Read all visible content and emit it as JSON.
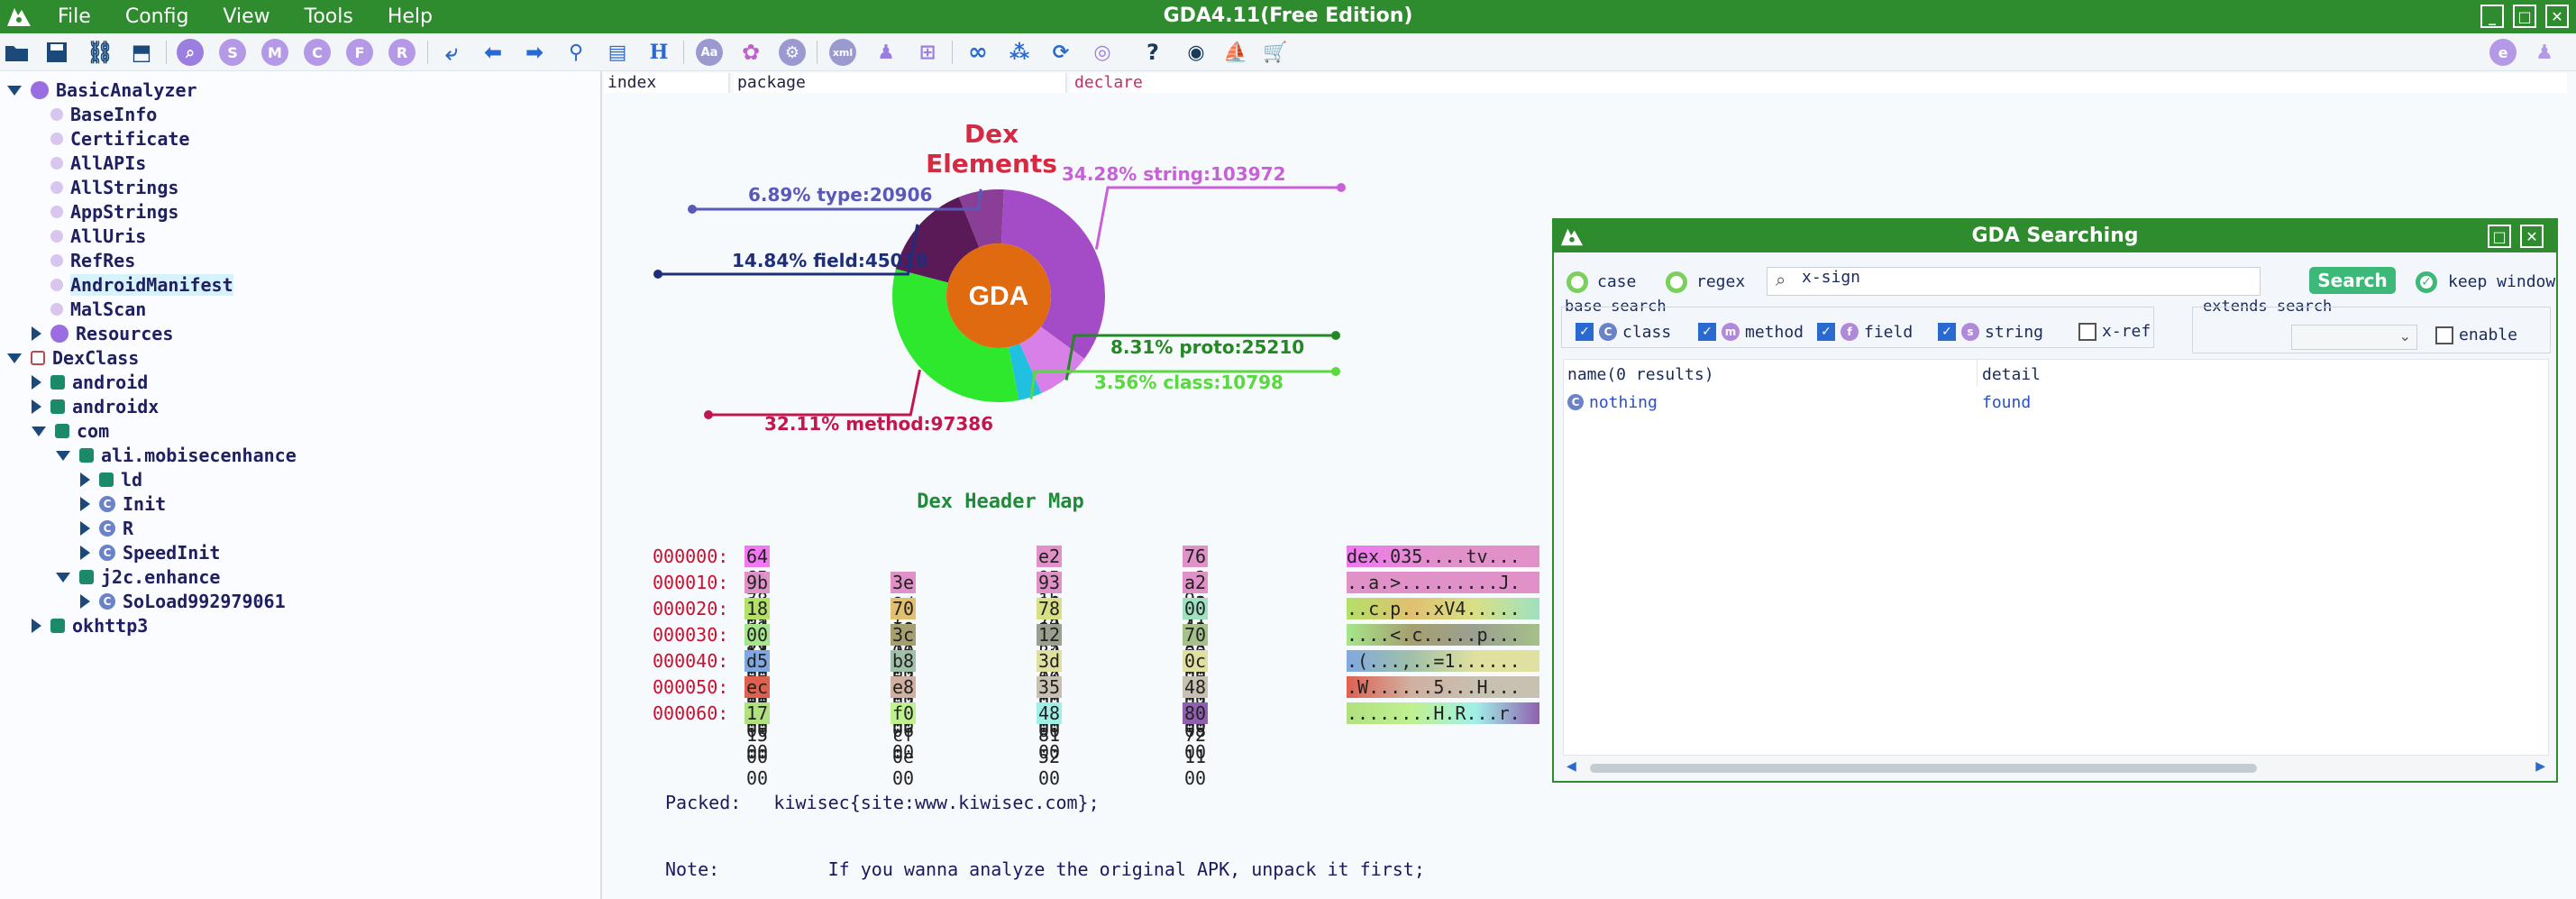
{
  "window": {
    "title": "GDA4.11(Free Edition)"
  },
  "menu": [
    "File",
    "Config",
    "View",
    "Tools",
    "Help"
  ],
  "toolbar": {
    "letter_buttons": [
      "S",
      "M",
      "C",
      "F",
      "R"
    ],
    "h_label": "H",
    "aa_label": "Aa",
    "xml_label": "xml",
    "help_label": "?"
  },
  "tree": [
    {
      "label": "BasicAnalyzer",
      "level": 0,
      "toggle": "expanded",
      "icon": "basic-analyzer-icon"
    },
    {
      "label": "BaseInfo",
      "level": 1,
      "toggle": "none",
      "icon": "dot-icon"
    },
    {
      "label": "Certificate",
      "level": 1,
      "toggle": "none",
      "icon": "dot-icon"
    },
    {
      "label": "AllAPIs",
      "level": 1,
      "toggle": "none",
      "icon": "dot-icon"
    },
    {
      "label": "AllStrings",
      "level": 1,
      "toggle": "none",
      "icon": "dot-icon"
    },
    {
      "label": "AppStrings",
      "level": 1,
      "toggle": "none",
      "icon": "dot-icon"
    },
    {
      "label": "AllUris",
      "level": 1,
      "toggle": "none",
      "icon": "dot-icon"
    },
    {
      "label": "RefRes",
      "level": 1,
      "toggle": "none",
      "icon": "dot-icon"
    },
    {
      "label": "AndroidManifest",
      "level": 1,
      "toggle": "none",
      "icon": "dot-icon",
      "selected": true
    },
    {
      "label": "MalScan",
      "level": 1,
      "toggle": "none",
      "icon": "dot-icon"
    },
    {
      "label": "Resources",
      "level": 1,
      "toggle": "collapsed",
      "icon": "resources-icon"
    },
    {
      "label": "DexClass",
      "level": 0,
      "toggle": "expanded",
      "icon": "dexclass-icon"
    },
    {
      "label": "android",
      "level": 1,
      "toggle": "collapsed",
      "icon": "package-icon"
    },
    {
      "label": "androidx",
      "level": 1,
      "toggle": "collapsed",
      "icon": "package-icon"
    },
    {
      "label": "com",
      "level": 1,
      "toggle": "expanded",
      "icon": "package-icon"
    },
    {
      "label": "ali.mobisecenhance",
      "level": 2,
      "toggle": "expanded",
      "icon": "package-icon"
    },
    {
      "label": "ld",
      "level": 3,
      "toggle": "collapsed",
      "icon": "package-icon"
    },
    {
      "label": "Init",
      "level": 3,
      "toggle": "collapsed",
      "icon": "class-icon"
    },
    {
      "label": "R",
      "level": 3,
      "toggle": "collapsed",
      "icon": "class-icon"
    },
    {
      "label": "SpeedInit",
      "level": 3,
      "toggle": "collapsed",
      "icon": "class-icon"
    },
    {
      "label": "j2c.enhance",
      "level": 2,
      "toggle": "expanded",
      "icon": "package-icon"
    },
    {
      "label": "SoLoad992979061",
      "level": 3,
      "toggle": "collapsed",
      "icon": "class-icon"
    },
    {
      "label": "okhttp3",
      "level": 1,
      "toggle": "collapsed",
      "icon": "package-icon"
    }
  ],
  "tabs": {
    "index": "index",
    "package": "package",
    "declare": "declare"
  },
  "chart_data": {
    "type": "pie",
    "title": "Dex Elements",
    "center_label": "GDA",
    "slices": [
      {
        "label": "34.28% string:103972",
        "name": "string",
        "percent": 34.28,
        "value": 103972,
        "color": "#a44cc8"
      },
      {
        "label": "8.31% proto:25210",
        "name": "proto",
        "percent": 8.31,
        "value": 25210,
        "color": "#d97fe8"
      },
      {
        "label": "3.56% class:10798",
        "name": "class",
        "percent": 3.56,
        "value": 10798,
        "color": "#22c0e0"
      },
      {
        "label": "32.11% method:97386",
        "name": "method",
        "percent": 32.11,
        "value": 97386,
        "color": "#2ee82e"
      },
      {
        "label": "14.84% field:45018",
        "name": "field",
        "percent": 14.84,
        "value": 45018,
        "color": "#5a1a58"
      },
      {
        "label": "6.89% type:20906",
        "name": "type",
        "percent": 6.89,
        "value": 20906,
        "color": "#8a3e96"
      }
    ],
    "label_colors": {
      "string": "#c860d8",
      "proto": "#238a23",
      "class": "#59d93f",
      "method": "#c0184c",
      "field": "#1e2e7a",
      "type": "#5a58b8"
    }
  },
  "dex_header": {
    "title": "Dex Header Map",
    "rows": [
      {
        "offset": "000000:",
        "segs": [
          {
            "t": "64 65 78 0a 30 33 35 00",
            "c": "#f078f0"
          },
          {
            "t": "e2 95 1b 74",
            "c": "#e092c8"
          },
          {
            "t": "76 c2 9a f1",
            "c": "#e092c8"
          }
        ],
        "ascii": "dex.035....tv..."
      },
      {
        "offset": "000010:",
        "segs": [
          {
            "t": "9b 14 61 f1",
            "c": "#e092c8"
          },
          {
            "t": "3e 8d fe 11",
            "c": "#e092c8"
          },
          {
            "t": "93 86 e3 c5",
            "c": "#e092c8"
          },
          {
            "t": "a2 d6 4a 83",
            "c": "#e092c8"
          }
        ],
        "ascii": "..a.>.........J."
      },
      {
        "offset": "000020:",
        "segs": [
          {
            "t": "18 f4 63 00",
            "c": "#b4e068"
          },
          {
            "t": "70 00 00 00",
            "c": "#e0c070"
          },
          {
            "t": "78 56 34 12",
            "c": "#d8e086"
          },
          {
            "t": "00 00 00 00",
            "c": "#a0e0c0"
          }
        ],
        "ascii": "..c.p...xV4....."
      },
      {
        "offset": "000030:",
        "segs": [
          {
            "t": "00 00 00 00",
            "c": "#a6e68a"
          },
          {
            "t": "3c f3 63 00",
            "c": "#a6a070"
          },
          {
            "t": "12 cb 00 00",
            "c": "#9aa090"
          },
          {
            "t": "70 00 00 00",
            "c": "#a6c08a"
          }
        ],
        "ascii": "....<.c.....p..."
      },
      {
        "offset": "000040:",
        "segs": [
          {
            "t": "d5 28 00 00",
            "c": "#80a8e0"
          },
          {
            "t": "b8 2c 03 00",
            "c": "#a0c0a8"
          },
          {
            "t": "3d 31 00 00",
            "c": "#e0e0a0"
          },
          {
            "t": "0c d0 03 00",
            "c": "#e0e0a0"
          }
        ],
        "ascii": ".(...,..=1......"
      },
      {
        "offset": "000050:",
        "segs": [
          {
            "t": "ec 57 00 00",
            "c": "#e06050"
          },
          {
            "t": "e8 1e 06 00",
            "c": "#d0b0a0"
          },
          {
            "t": "35 be 00 00",
            "c": "#c8c0b0"
          },
          {
            "t": "48 de 08 00",
            "c": "#c8c0b0"
          }
        ],
        "ascii": ".W......5...H..."
      },
      {
        "offset": "000060:",
        "segs": [
          {
            "t": "17 15 00 00",
            "c": "#b0e080"
          },
          {
            "t": "f0 cf 0e 00",
            "c": "#c0f090"
          },
          {
            "t": "48 81 52 00",
            "c": "#a0f0e8"
          },
          {
            "t": "80 72 11 00",
            "c": "#9060b0"
          }
        ],
        "ascii": "........H.R...r."
      }
    ]
  },
  "packed_info": {
    "packed_line": "Packed:   kiwisec{site:www.kiwisec.com};",
    "note_line": "Note:          If you wanna analyze the original APK, unpack it first;"
  },
  "search": {
    "title": "GDA Searching",
    "case_label": "case",
    "regex_label": "regex",
    "query": "x-sign",
    "search_button": "Search",
    "keep_window_label": "keep window",
    "base_search_label": "base search",
    "extends_search_label": "extends search",
    "options": [
      {
        "label": "class",
        "checked": true,
        "badge": "C",
        "badge_color": "#6a82c8"
      },
      {
        "label": "method",
        "checked": true,
        "badge": "m",
        "badge_color": "#b08ad8"
      },
      {
        "label": "field",
        "checked": true,
        "badge": "f",
        "badge_color": "#b08ad8"
      },
      {
        "label": "string",
        "checked": true,
        "badge": "s",
        "badge_color": "#b08ad8"
      }
    ],
    "xref_label": "x-ref",
    "enable_label": "enable",
    "col_name": "name(0 results)",
    "col_detail": "detail",
    "result_name": "nothing",
    "result_detail": "found"
  }
}
